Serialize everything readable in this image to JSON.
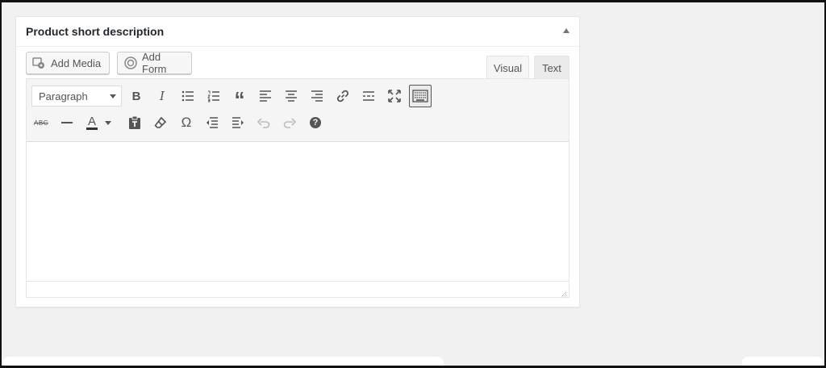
{
  "postbox": {
    "title": "Product short description"
  },
  "media_buttons": {
    "add_media": "Add Media",
    "add_form": "Add Form"
  },
  "tabs": {
    "visual": "Visual",
    "text": "Text"
  },
  "toolbar": {
    "format_select": "Paragraph",
    "row1_icons": [
      "bold-icon",
      "italic-icon",
      "bullet-list-icon",
      "numbered-list-icon",
      "blockquote-icon",
      "align-left-icon",
      "align-center-icon",
      "align-right-icon",
      "link-icon",
      "read-more-icon",
      "fullscreen-icon",
      "toolbar-toggle-icon"
    ],
    "row2_icons": [
      "strikethrough-icon",
      "horizontal-line-icon",
      "text-color-icon",
      "paste-as-text-icon",
      "clear-formatting-icon",
      "special-character-icon",
      "outdent-icon",
      "indent-icon",
      "undo-icon",
      "redo-icon",
      "help-icon"
    ],
    "bold_glyph": "B",
    "italic_glyph": "I",
    "quote_glyph": "“",
    "strike_glyph": "ABC",
    "text_color_glyph": "A",
    "omega_glyph": "Ω",
    "help_glyph": "?"
  },
  "colors": {
    "page_bg": "#f1f1f1",
    "toolbar_bg": "#f5f5f5",
    "icon": "#555555",
    "border": "#e5e5e5"
  }
}
